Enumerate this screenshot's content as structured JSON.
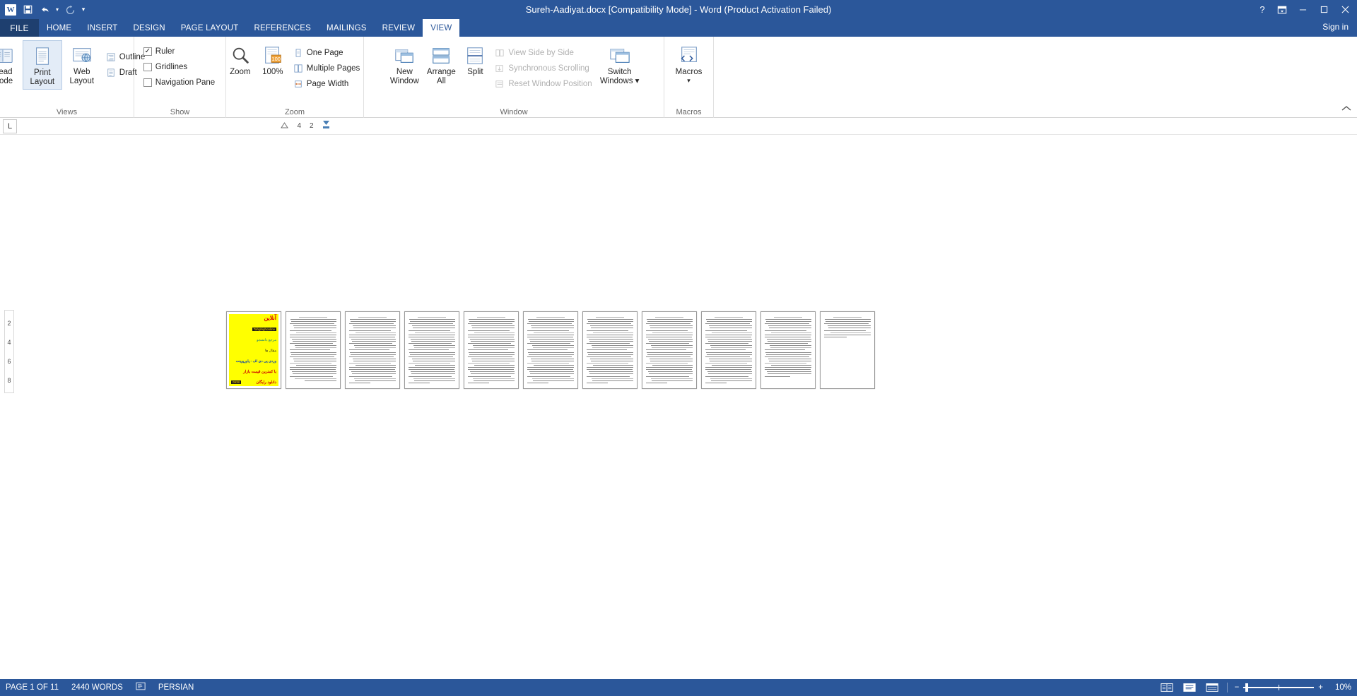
{
  "titlebar": {
    "logo_text": "W",
    "quick_access": [
      {
        "name": "save",
        "glyph": "὚b"
      },
      {
        "name": "undo",
        "glyph": "↶"
      },
      {
        "name": "redo",
        "glyph": "↻"
      },
      {
        "name": "customize",
        "glyph": "▾"
      }
    ],
    "title": "Sureh-Aadiyat.docx [Compatibility Mode] - Word (Product Activation Failed)",
    "help": "?",
    "ribbon_display_options": "❐",
    "minimize": "—",
    "restore": "❐",
    "close": "✕"
  },
  "tabs": {
    "file": "FILE",
    "items": [
      {
        "label": "HOME",
        "active": false
      },
      {
        "label": "INSERT",
        "active": false
      },
      {
        "label": "DESIGN",
        "active": false
      },
      {
        "label": "PAGE LAYOUT",
        "active": false
      },
      {
        "label": "REFERENCES",
        "active": false
      },
      {
        "label": "MAILINGS",
        "active": false
      },
      {
        "label": "REVIEW",
        "active": false
      },
      {
        "label": "VIEW",
        "active": true
      }
    ],
    "signin": "Sign in"
  },
  "ribbon": {
    "groups": {
      "views": {
        "label": "Views",
        "buttons": [
          {
            "label_line1": "Read",
            "label_line2": "Mode",
            "name": "read-mode-button",
            "selected": false
          },
          {
            "label_line1": "Print",
            "label_line2": "Layout",
            "name": "print-layout-button",
            "selected": true
          },
          {
            "label_line1": "Web",
            "label_line2": "Layout",
            "name": "web-layout-button",
            "selected": false
          }
        ],
        "small": [
          {
            "label": "Outline",
            "name": "outline-button"
          },
          {
            "label": "Draft",
            "name": "draft-button"
          }
        ]
      },
      "show": {
        "label": "Show",
        "checks": [
          {
            "label": "Ruler",
            "checked": true,
            "name": "ruler-checkbox"
          },
          {
            "label": "Gridlines",
            "checked": false,
            "name": "gridlines-checkbox"
          },
          {
            "label": "Navigation Pane",
            "checked": false,
            "name": "navigation-pane-checkbox"
          }
        ]
      },
      "zoom": {
        "label": "Zoom",
        "buttons": [
          {
            "label": "Zoom",
            "name": "zoom-button"
          },
          {
            "label": "100%",
            "name": "zoom-100-button"
          }
        ],
        "small": [
          {
            "label": "One Page",
            "name": "one-page-button"
          },
          {
            "label": "Multiple Pages",
            "name": "multiple-pages-button"
          },
          {
            "label": "Page Width",
            "name": "page-width-button"
          }
        ]
      },
      "window": {
        "label": "Window",
        "buttons": [
          {
            "label_line1": "New",
            "label_line2": "Window",
            "name": "new-window-button"
          },
          {
            "label_line1": "Arrange",
            "label_line2": "All",
            "name": "arrange-all-button"
          },
          {
            "label_line1": "Split",
            "label_line2": "",
            "name": "split-button"
          }
        ],
        "small": [
          {
            "label": "View Side by Side",
            "name": "view-side-by-side-button",
            "disabled": true
          },
          {
            "label": "Synchronous Scrolling",
            "name": "synchronous-scrolling-button",
            "disabled": true
          },
          {
            "label": "Reset Window Position",
            "name": "reset-window-position-button",
            "disabled": true
          }
        ],
        "switch_windows": {
          "label_line1": "Switch",
          "label_line2": "Windows",
          "name": "switch-windows-button"
        }
      },
      "macros": {
        "label": "Macros",
        "button": {
          "label": "Macros",
          "name": "macros-button"
        }
      }
    },
    "collapse_icon": "⌃"
  },
  "ruler": {
    "tab_stop_glyph": "L",
    "marks": [
      "4",
      "2"
    ]
  },
  "vertical_ruler": {
    "marks": [
      "2",
      "4",
      "6",
      "8"
    ]
  },
  "document": {
    "page_count": 11,
    "cover": {
      "title_fa": "آنلاین",
      "brand": "Tahghighonline",
      "sub1": "مرجع دانشجو",
      "sub2": "مقال ها",
      "sub3": "وردی پی دی اف - پاورپوینت",
      "sub4": "با کمترین قیمت بازار",
      "phone": "0938",
      "footer": "دانلود رایگان"
    },
    "thumbnails": [
      {
        "index": 1,
        "type": "cover"
      },
      {
        "index": 2,
        "type": "text",
        "lines": 30
      },
      {
        "index": 3,
        "type": "text",
        "lines": 31
      },
      {
        "index": 4,
        "type": "text",
        "lines": 31
      },
      {
        "index": 5,
        "type": "text",
        "lines": 31
      },
      {
        "index": 6,
        "type": "text",
        "lines": 31
      },
      {
        "index": 7,
        "type": "text",
        "lines": 31
      },
      {
        "index": 8,
        "type": "text",
        "lines": 31
      },
      {
        "index": 9,
        "type": "text",
        "lines": 31
      },
      {
        "index": 10,
        "type": "text",
        "lines": 28
      },
      {
        "index": 11,
        "type": "text",
        "lines": 10
      }
    ]
  },
  "statusbar": {
    "page": "PAGE 1 OF 11",
    "words": "2440 WORDS",
    "proofing_icon": "✓",
    "language": "PERSIAN",
    "views": [
      {
        "name": "read-mode-view-button",
        "glyph": "▤"
      },
      {
        "name": "print-layout-view-button",
        "glyph": "▧"
      },
      {
        "name": "web-layout-view-button",
        "glyph": "▦"
      }
    ],
    "zoom_out": "−",
    "zoom_in": "+",
    "zoom_level": "10%"
  }
}
